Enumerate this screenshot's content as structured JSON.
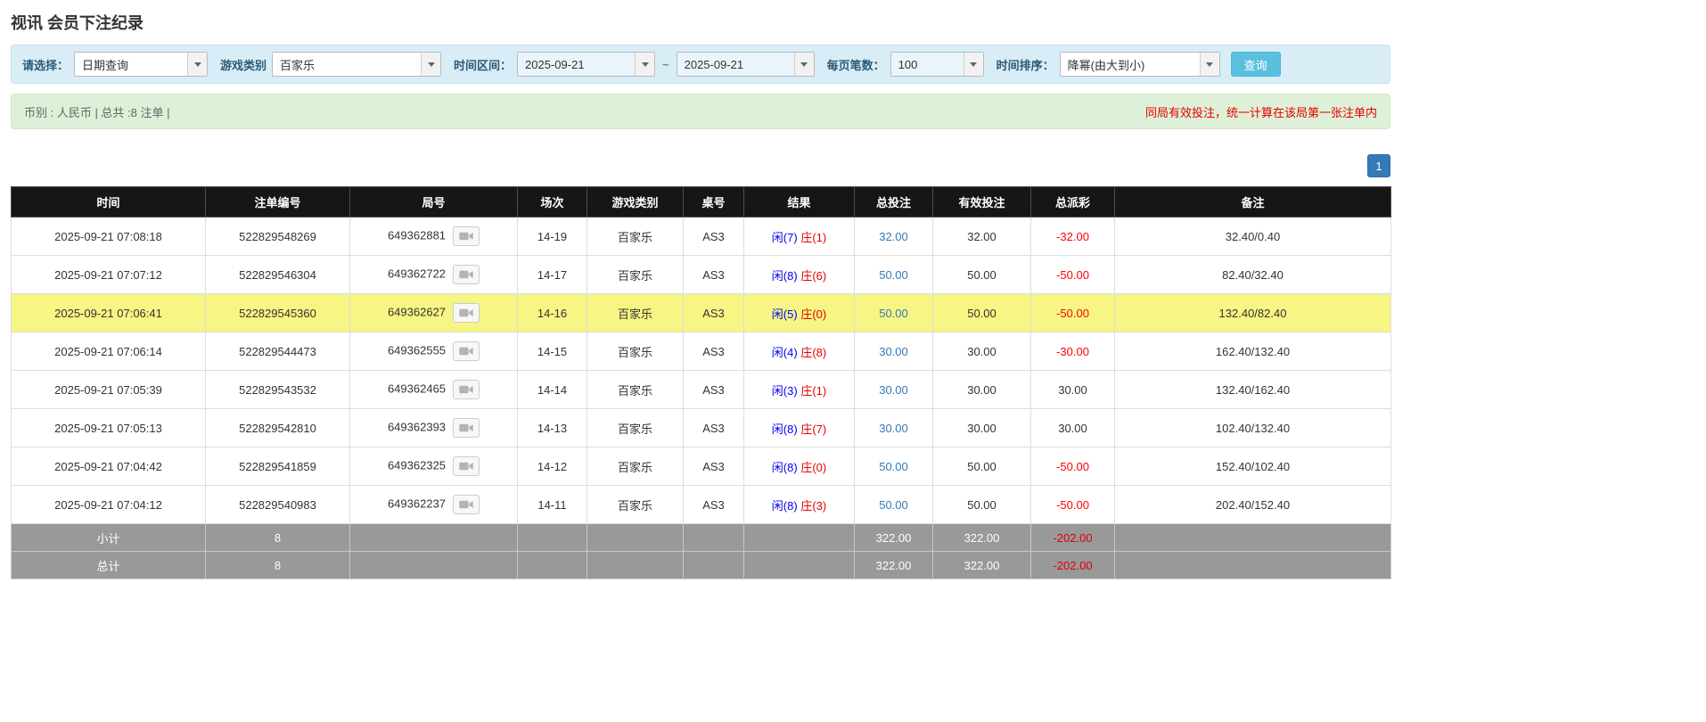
{
  "page": {
    "title": "视讯 会员下注纪录"
  },
  "filters": {
    "select_label": "请选择：",
    "select_value": "日期查询",
    "game_label": "游戏类别",
    "game_value": "百家乐",
    "range_label": "时间区间：",
    "date_from": "2025-09-21",
    "range_separator": "~",
    "date_to": "2025-09-21",
    "page_size_label": "每页笔数：",
    "page_size_value": "100",
    "sort_label": "时间排序：",
    "sort_value": "降幂(由大到小)",
    "search_label": "查询"
  },
  "info_bar": {
    "summary": "币别 : 人民币 | 总共 :8 注单 |",
    "notice": "同局有效投注，统一计算在该局第一张注单内"
  },
  "pagination": {
    "current_page": "1"
  },
  "table": {
    "headers": [
      "时间",
      "注单编号",
      "局号",
      "场次",
      "游戏类别",
      "桌号",
      "结果",
      "总投注",
      "有效投注",
      "总派彩",
      "备注"
    ],
    "rows": [
      {
        "time": "2025-09-21 07:08:18",
        "bet_id": "522829548269",
        "round_id": "649362881",
        "session": "14-19",
        "game": "百家乐",
        "table_no": "AS3",
        "result_player": "闲(7)",
        "result_banker": "庄(1)",
        "total_bet": "32.00",
        "valid_bet": "32.00",
        "payout": "-32.00",
        "note": "32.40/0.40",
        "highlighted": false
      },
      {
        "time": "2025-09-21 07:07:12",
        "bet_id": "522829546304",
        "round_id": "649362722",
        "session": "14-17",
        "game": "百家乐",
        "table_no": "AS3",
        "result_player": "闲(8)",
        "result_banker": "庄(6)",
        "total_bet": "50.00",
        "valid_bet": "50.00",
        "payout": "-50.00",
        "note": "82.40/32.40",
        "highlighted": false
      },
      {
        "time": "2025-09-21 07:06:41",
        "bet_id": "522829545360",
        "round_id": "649362627",
        "session": "14-16",
        "game": "百家乐",
        "table_no": "AS3",
        "result_player": "闲(5)",
        "result_banker": "庄(0)",
        "total_bet": "50.00",
        "valid_bet": "50.00",
        "payout": "-50.00",
        "note": "132.40/82.40",
        "highlighted": true
      },
      {
        "time": "2025-09-21 07:06:14",
        "bet_id": "522829544473",
        "round_id": "649362555",
        "session": "14-15",
        "game": "百家乐",
        "table_no": "AS3",
        "result_player": "闲(4)",
        "result_banker": "庄(8)",
        "total_bet": "30.00",
        "valid_bet": "30.00",
        "payout": "-30.00",
        "note": "162.40/132.40",
        "highlighted": false
      },
      {
        "time": "2025-09-21 07:05:39",
        "bet_id": "522829543532",
        "round_id": "649362465",
        "session": "14-14",
        "game": "百家乐",
        "table_no": "AS3",
        "result_player": "闲(3)",
        "result_banker": "庄(1)",
        "total_bet": "30.00",
        "valid_bet": "30.00",
        "payout": "30.00",
        "note": "132.40/162.40",
        "highlighted": false
      },
      {
        "time": "2025-09-21 07:05:13",
        "bet_id": "522829542810",
        "round_id": "649362393",
        "session": "14-13",
        "game": "百家乐",
        "table_no": "AS3",
        "result_player": "闲(8)",
        "result_banker": "庄(7)",
        "total_bet": "30.00",
        "valid_bet": "30.00",
        "payout": "30.00",
        "note": "102.40/132.40",
        "highlighted": false
      },
      {
        "time": "2025-09-21 07:04:42",
        "bet_id": "522829541859",
        "round_id": "649362325",
        "session": "14-12",
        "game": "百家乐",
        "table_no": "AS3",
        "result_player": "闲(8)",
        "result_banker": "庄(0)",
        "total_bet": "50.00",
        "valid_bet": "50.00",
        "payout": "-50.00",
        "note": "152.40/102.40",
        "highlighted": false
      },
      {
        "time": "2025-09-21 07:04:12",
        "bet_id": "522829540983",
        "round_id": "649362237",
        "session": "14-11",
        "game": "百家乐",
        "table_no": "AS3",
        "result_player": "闲(8)",
        "result_banker": "庄(3)",
        "total_bet": "50.00",
        "valid_bet": "50.00",
        "payout": "-50.00",
        "note": "202.40/152.40",
        "highlighted": false
      }
    ],
    "subtotal": {
      "label": "小计",
      "count": "8",
      "total_bet": "322.00",
      "valid_bet": "322.00",
      "payout": "-202.00"
    },
    "grand_total": {
      "label": "总计",
      "count": "8",
      "total_bet": "322.00",
      "valid_bet": "322.00",
      "payout": "-202.00"
    }
  },
  "colors": {
    "accent_blue": "#5bc0de",
    "pagination_blue": "#337ab7",
    "player_blue": "#0000ee",
    "banker_red": "#e60000",
    "negative_red": "#ff0000",
    "highlight_yellow": "#f7f584",
    "header_black": "#161616",
    "footer_gray": "#999999",
    "filter_bg": "#d9edf7",
    "info_bg": "#dff0d8"
  }
}
